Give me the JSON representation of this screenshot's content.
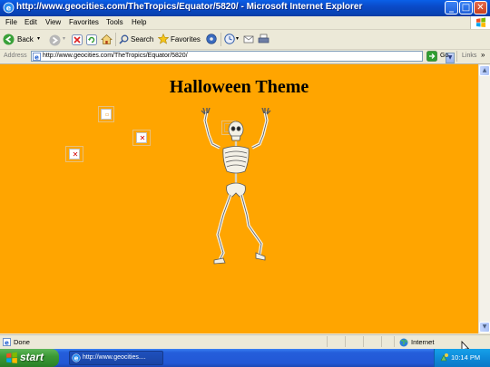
{
  "window": {
    "title": "http://www.geocities.com/TheTropics/Equator/5820/ - Microsoft Internet Explorer",
    "minimize": "_",
    "maximize": "□",
    "close": "✕"
  },
  "menu": {
    "items": [
      "File",
      "Edit",
      "View",
      "Favorites",
      "Tools",
      "Help"
    ]
  },
  "toolbar": {
    "back_label": "Back",
    "search_label": "Search",
    "favorites_label": "Favorites"
  },
  "address_bar": {
    "label": "Address",
    "url": "http://www.geocities.com/TheTropics/Equator/5820/",
    "go_label": "Go",
    "links_label": "Links"
  },
  "page": {
    "heading": "Halloween Theme",
    "background_color": "#FFA500"
  },
  "status_bar": {
    "status": "Done",
    "zone": "Internet"
  },
  "taskbar": {
    "start_label": "start",
    "task_button_label": "http://www.geocities....",
    "clock": "10:14 PM"
  },
  "colors": {
    "titlebar": "#0A4AC8",
    "content_bg": "#FFA500",
    "taskbar": "#245EDB",
    "start_green": "#3C9A36"
  }
}
